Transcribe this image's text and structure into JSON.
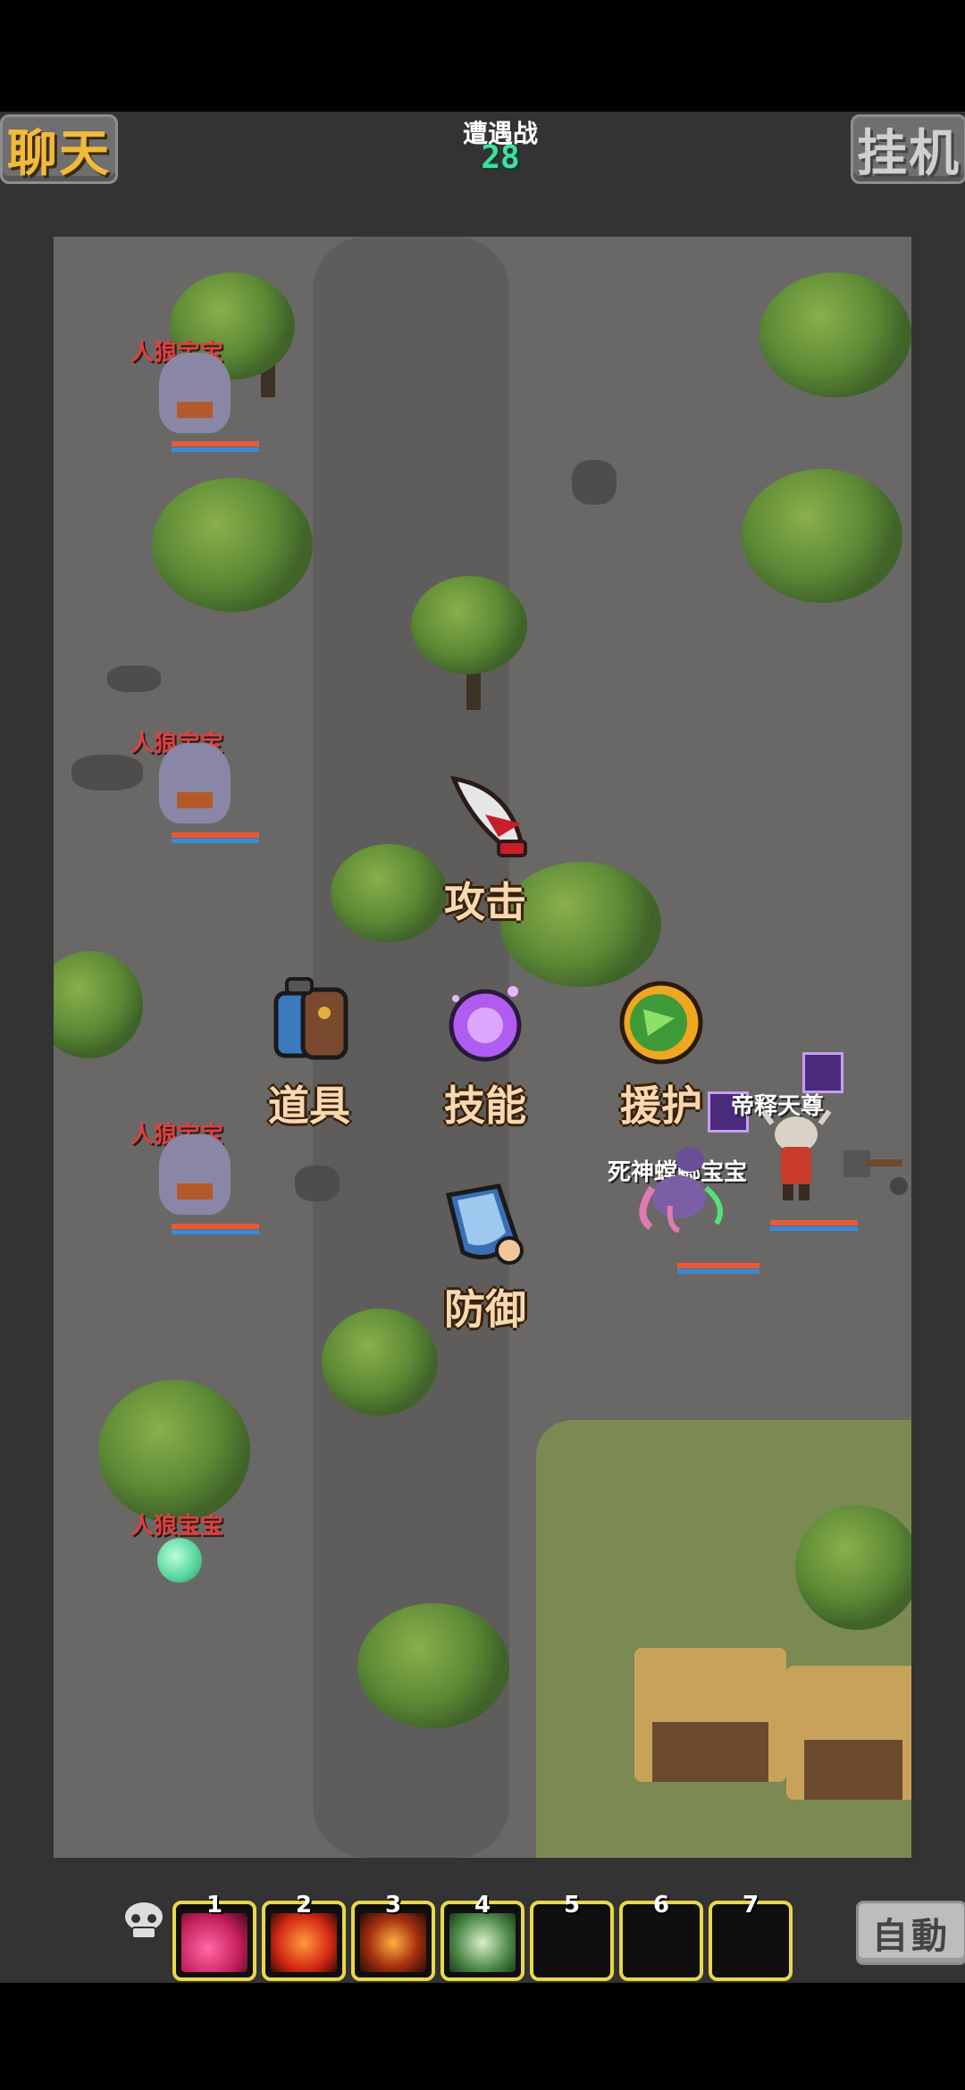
{
  "header": {
    "chat_label": "聊天",
    "battle_title": "遭遇战",
    "battle_counter": "28",
    "hangup_label": "挂机"
  },
  "units": {
    "enemy_1": "人狼宝宝",
    "enemy_2": "人狼宝宝",
    "enemy_3": "人狼宝宝",
    "enemy_4": "人狼宝宝",
    "ally_pet": "死神螳螂宝宝",
    "player": "帝释天尊"
  },
  "actions": {
    "attack": "攻击",
    "item": "道具",
    "skill": "技能",
    "assist": "援护",
    "defend": "防御"
  },
  "skillbar": {
    "slots": [
      "1",
      "2",
      "3",
      "4",
      "5",
      "6",
      "7"
    ],
    "auto_label": "自動"
  },
  "icons": {
    "attack": "bloody-blade-icon",
    "item": "backpack-icon",
    "skill": "purple-magic-orb-icon",
    "assist": "green-emblem-icon",
    "defend": "shield-fist-icon",
    "skull": "skull-icon"
  },
  "colors": {
    "accent_yellow": "#e8d84a",
    "enemy_label": "#e04040",
    "counter_green": "#3fe0a0"
  }
}
